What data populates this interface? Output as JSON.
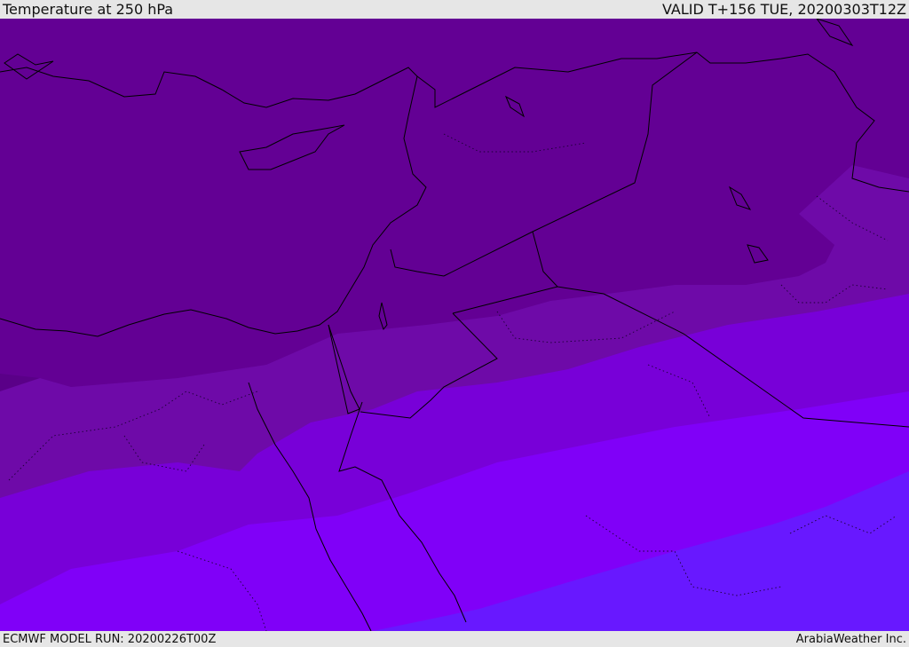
{
  "header": {
    "title": "Temperature at 250 hPa",
    "valid_time": "VALID T+156 TUE, 20200303T12Z"
  },
  "footer": {
    "model_run": "ECMWF MODEL RUN: 20200226T00Z",
    "credit": "ArabiaWeather Inc."
  },
  "map": {
    "field": "temperature_250hPa",
    "band_colors": [
      "#4e0078",
      "#5a0088",
      "#630094",
      "#6e0aa8",
      "#7800d8",
      "#8000f8",
      "#6818ff"
    ],
    "coastline_color": "#000000",
    "border_color": "#000000"
  }
}
